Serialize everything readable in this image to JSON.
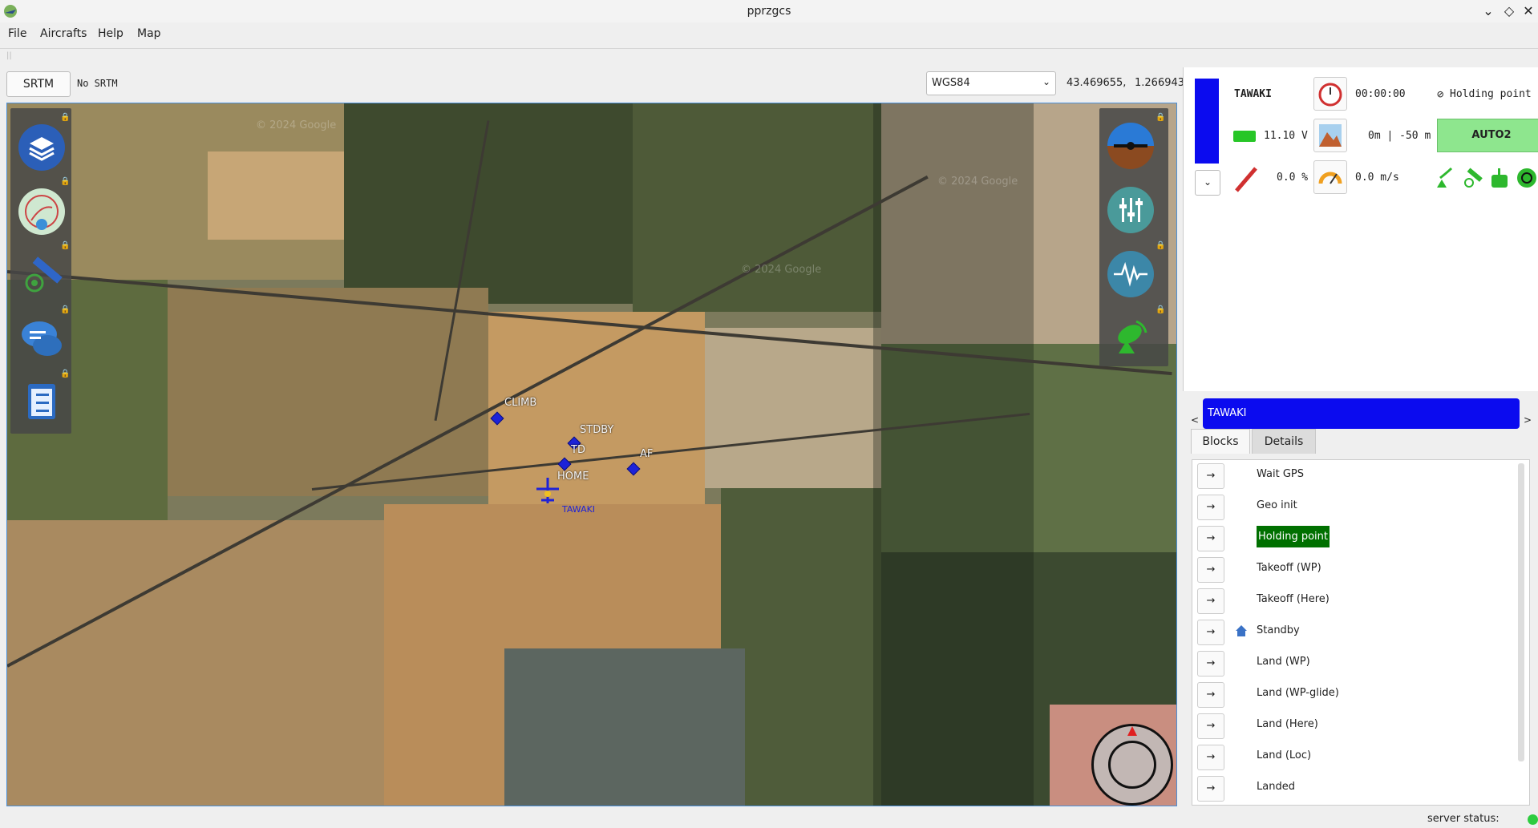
{
  "window": {
    "title": "pprzgcs",
    "buttons": [
      "⌄",
      "◇",
      "✕"
    ]
  },
  "menubar": {
    "items": [
      "File",
      "Aircrafts",
      "Help",
      "Map"
    ]
  },
  "toolbar": {
    "srtm_button": "SRTM",
    "srtm_status": "No SRTM",
    "coord_system": "WGS84",
    "latitude": "43.469655,",
    "longitude": "1.266943"
  },
  "map": {
    "left_tools": [
      "layers-icon",
      "flightplan-icon",
      "satellite-icon",
      "chat-icon",
      "checklist-icon"
    ],
    "right_tools": [
      "attitude-icon",
      "settings-sliders-icon",
      "signal-icon",
      "ground-antenna-icon"
    ],
    "waypoints": [
      {
        "label": "CLIMB"
      },
      {
        "label": "STDBY"
      },
      {
        "label": "TD"
      },
      {
        "label": "AF"
      },
      {
        "label": "HOME"
      }
    ],
    "aircraft_label": "TAWAKI",
    "watermark": "© 2024 Google"
  },
  "strip": {
    "aircraft_name": "TAWAKI",
    "flight_time": "00:00:00",
    "current_block": "Holding point",
    "battery": "11.10 V",
    "altitude": "0m | -50 m",
    "mode": "AUTO2",
    "throttle": "0.0 %",
    "climb_rate": "0.0 m/s",
    "colors": {
      "aircraft": "#0b0bef",
      "mode_bg": "#8ee68e",
      "battery": "#27c627"
    }
  },
  "aircraft_selector": {
    "name": "TAWAKI",
    "prev": "<",
    "next": ">"
  },
  "tabs": {
    "blocks": "Blocks",
    "details": "Details"
  },
  "blocks": {
    "button_label": "→",
    "items": [
      {
        "name": "Wait GPS",
        "active": false
      },
      {
        "name": "Geo init",
        "active": false
      },
      {
        "name": "Holding point",
        "active": true
      },
      {
        "name": "Takeoff (WP)",
        "active": false
      },
      {
        "name": "Takeoff (Here)",
        "active": false
      },
      {
        "name": "Standby",
        "active": false,
        "icon": "home-icon"
      },
      {
        "name": "Land (WP)",
        "active": false
      },
      {
        "name": "Land (WP-glide)",
        "active": false
      },
      {
        "name": "Land (Here)",
        "active": false
      },
      {
        "name": "Land (Loc)",
        "active": false
      },
      {
        "name": "Landed",
        "active": false
      }
    ],
    "active_color": "#007000"
  },
  "statusbar": {
    "server_label": "server status:",
    "server_color": "#2ecc40"
  }
}
